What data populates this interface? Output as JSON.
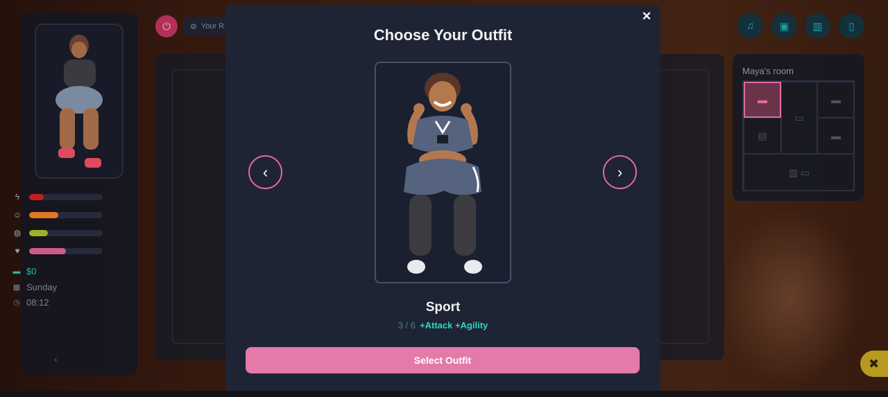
{
  "modal": {
    "title": "Choose Your Outfit",
    "close_icon": "✕",
    "outfit_name": "Sport",
    "outfit_counter": "3 / 6",
    "outfit_bonus": "+Attack +Agility",
    "select_label": "Select Outfit",
    "prev_icon": "‹",
    "next_icon": "›"
  },
  "sidebar": {
    "stats": [
      {
        "icon": "lightning-icon",
        "glyph": "ϟ",
        "fill": 0.2,
        "color": "#c0201c"
      },
      {
        "icon": "smile-icon",
        "glyph": "☺",
        "fill": 0.4,
        "color": "#e07a20"
      },
      {
        "icon": "brain-icon",
        "glyph": "◍",
        "fill": 0.25,
        "color": "#9ab42a"
      },
      {
        "icon": "heart-icon",
        "glyph": "♥",
        "fill": 0.5,
        "color": "#d05a8a"
      }
    ],
    "money": "$0",
    "day": "Sunday",
    "time": "08:12",
    "collapse_icon": "‹"
  },
  "topbar": {
    "your_label": "Your R"
  },
  "room": {
    "title": "Maya's room"
  },
  "colors": {
    "accent": "#e47aa9",
    "bonus": "#2fd6c3",
    "modal_bg": "#1e2434"
  }
}
